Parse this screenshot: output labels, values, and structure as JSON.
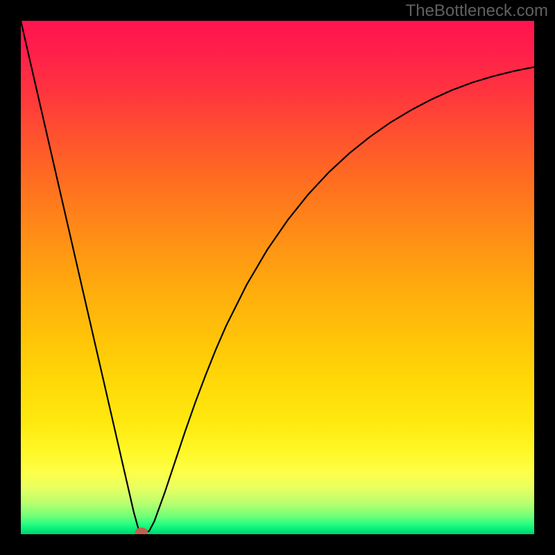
{
  "watermark": {
    "text": "TheBottleneck.com"
  },
  "colors": {
    "frame": "#000000",
    "gradient_top": "#ff1450",
    "gradient_mid": "#ffc408",
    "gradient_low": "#fff828",
    "gradient_bottom": "#00d070",
    "curve": "#000000",
    "marker": "#c0614e"
  },
  "chart_data": {
    "type": "line",
    "title": "",
    "xlabel": "",
    "ylabel": "",
    "xlim": [
      0,
      100
    ],
    "ylim": [
      0,
      100
    ],
    "x": [
      0,
      2,
      4,
      6,
      8,
      10,
      12,
      14,
      16,
      18,
      20,
      22,
      23,
      24,
      25,
      26,
      28,
      30,
      32,
      34,
      36,
      38,
      40,
      44,
      48,
      52,
      56,
      60,
      64,
      68,
      72,
      76,
      80,
      84,
      88,
      92,
      96,
      100
    ],
    "values": [
      100,
      91.3,
      82.6,
      73.9,
      65.2,
      56.5,
      47.8,
      39.1,
      30.4,
      21.7,
      13.0,
      4.3,
      0.7,
      0.3,
      0.6,
      2.5,
      8.0,
      14.0,
      20.0,
      25.7,
      31.0,
      36.0,
      40.6,
      48.6,
      55.4,
      61.2,
      66.2,
      70.5,
      74.2,
      77.4,
      80.2,
      82.6,
      84.7,
      86.5,
      88.0,
      89.2,
      90.2,
      91.0
    ],
    "marker": {
      "x": 23.5,
      "y": 0.4,
      "size": 1.4
    },
    "notes": "y is a unitless bottleneck-percentage style metric; 0 is best (green), 100 is worst (red). Gradient background encodes the same scale top-to-bottom. Curve shows sharp V with minimum near x≈23 then asymptotic rise."
  }
}
